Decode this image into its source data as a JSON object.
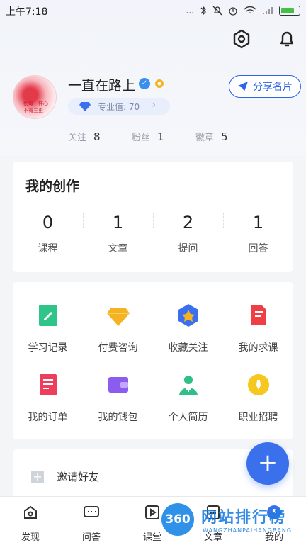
{
  "status_bar": {
    "time": "上午7:18",
    "signal_note": "..."
  },
  "profile": {
    "username": "一直在路上",
    "pro_label": "专业值: 70",
    "share_button": "分享名片",
    "avatar_text": "杨每一样心 · 不有三更",
    "stats": [
      {
        "label": "关注",
        "value": "8"
      },
      {
        "label": "粉丝",
        "value": "1"
      },
      {
        "label": "徽章",
        "value": "5"
      }
    ]
  },
  "works": {
    "title": "我的创作",
    "items": [
      {
        "count": "0",
        "label": "课程"
      },
      {
        "count": "1",
        "label": "文章"
      },
      {
        "count": "2",
        "label": "提问"
      },
      {
        "count": "1",
        "label": "回答"
      }
    ]
  },
  "tools": [
    {
      "label": "学习记录",
      "icon": "study-record-icon",
      "color": "#2fc58a"
    },
    {
      "label": "付费咨询",
      "icon": "diamond-icon",
      "color": "#f5b324"
    },
    {
      "label": "收藏关注",
      "icon": "star-hexagon-icon",
      "color": "#3a6ff0"
    },
    {
      "label": "我的求课",
      "icon": "course-request-icon",
      "color": "#ef3e46"
    },
    {
      "label": "我的订单",
      "icon": "order-icon",
      "color": "#ef3e5c"
    },
    {
      "label": "我的钱包",
      "icon": "wallet-icon",
      "color": "#8a5cf0"
    },
    {
      "label": "个人简历",
      "icon": "resume-icon",
      "color": "#2fbf88"
    },
    {
      "label": "职业招聘",
      "icon": "recruit-icon",
      "color": "#f5c71f"
    }
  ],
  "invite": {
    "label": "邀请好友"
  },
  "fab": {
    "label": "+"
  },
  "bottom_nav": [
    {
      "label": "发现",
      "icon": "discover-icon"
    },
    {
      "label": "问答",
      "icon": "qa-icon"
    },
    {
      "label": "课堂",
      "icon": "classroom-icon"
    },
    {
      "label": "文章",
      "icon": "article-icon"
    },
    {
      "label": "我的",
      "icon": "me-icon"
    }
  ],
  "watermark": {
    "badge": "360",
    "title": "网站排行榜",
    "subtitle": "WANGZHANPAIHANGBANG"
  },
  "colors": {
    "accent": "#2c64e6",
    "fab": "#3a70ec",
    "background": "#f4f5f7"
  }
}
